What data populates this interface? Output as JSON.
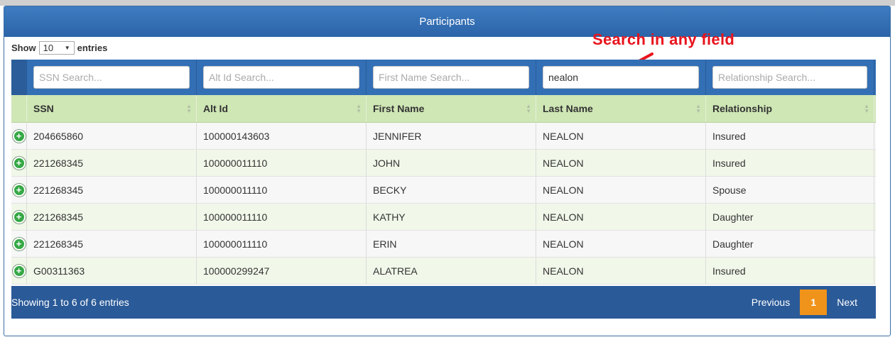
{
  "panel": {
    "title": "Participants"
  },
  "length": {
    "prefix": "Show",
    "value": "10",
    "suffix": "entries"
  },
  "annotation": {
    "text": "Search in any field",
    "color": "#e8141d"
  },
  "filters": [
    {
      "placeholder": "SSN Search...",
      "value": ""
    },
    {
      "placeholder": "Alt Id Search...",
      "value": ""
    },
    {
      "placeholder": "First Name Search...",
      "value": ""
    },
    {
      "placeholder": "",
      "value": "nealon"
    },
    {
      "placeholder": "Relationship Search...",
      "value": ""
    }
  ],
  "columns": [
    "SSN",
    "Alt Id",
    "First Name",
    "Last Name",
    "Relationship"
  ],
  "rows": [
    {
      "ssn": "204665860",
      "alt_id": "100000143603",
      "first": "JENNIFER",
      "last": "NEALON",
      "rel": "Insured"
    },
    {
      "ssn": "221268345",
      "alt_id": "100000011110",
      "first": "JOHN",
      "last": "NEALON",
      "rel": "Insured"
    },
    {
      "ssn": "221268345",
      "alt_id": "100000011110",
      "first": "BECKY",
      "last": "NEALON",
      "rel": "Spouse"
    },
    {
      "ssn": "221268345",
      "alt_id": "100000011110",
      "first": "KATHY",
      "last": "NEALON",
      "rel": "Daughter"
    },
    {
      "ssn": "221268345",
      "alt_id": "100000011110",
      "first": "ERIN",
      "last": "NEALON",
      "rel": "Daughter"
    },
    {
      "ssn": "G00311363",
      "alt_id": "100000299247",
      "first": "ALATREA",
      "last": "NEALON",
      "rel": "Insured"
    }
  ],
  "expand_icon": "plus-circle-icon",
  "footer": {
    "info": "Showing 1 to 6 of 6 entries",
    "previous": "Previous",
    "current_page": "1",
    "next": "Next"
  },
  "colors": {
    "header_blue": "#2c64a8",
    "header_green": "#cfe6b5",
    "accent_orange": "#f0931b",
    "footer_blue": "#2a5a98"
  }
}
